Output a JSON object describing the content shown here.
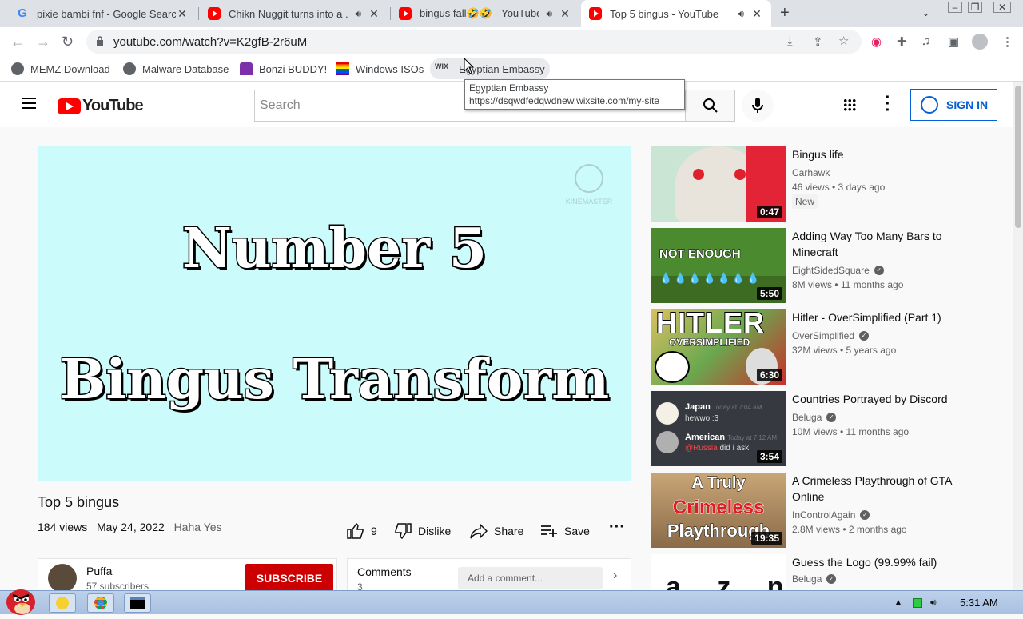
{
  "browser": {
    "tabs": [
      {
        "title": "pixie bambi fnf - Google Search",
        "favicon": "google-icon",
        "audio": false,
        "active": false
      },
      {
        "title": "Chikn Nuggit turns into a ...",
        "favicon": "youtube-icon",
        "audio": true,
        "active": false
      },
      {
        "title": "bingus fall🤣🤣 - YouTube",
        "favicon": "youtube-icon",
        "audio": true,
        "active": false
      },
      {
        "title": "Top 5 bingus - YouTube",
        "favicon": "youtube-icon",
        "audio": true,
        "active": true
      }
    ],
    "url": "youtube.com/watch?v=K2gfB-2r6uM",
    "bookmarks": [
      {
        "label": "MEMZ Download",
        "icon": "globe-icon"
      },
      {
        "label": "Malware Database",
        "icon": "globe-icon"
      },
      {
        "label": "Bonzi BUDDY!",
        "icon": "bonzi-icon"
      },
      {
        "label": "Windows ISOs",
        "icon": "rainbow-flag-icon"
      },
      {
        "label": "Egyptian Embassy",
        "icon": "wix-icon"
      }
    ],
    "tooltip": {
      "title": "Egyptian Embassy",
      "url": "https://dsqwdfedqwdnew.wixsite.com/my-site"
    }
  },
  "youtube": {
    "logo_text": "YouTube",
    "search_placeholder": "Search",
    "signin_label": "SIGN IN",
    "video": {
      "overlay_line1": "Number 5",
      "overlay_line2": "Bingus Transform",
      "watermark": "KINEMASTER",
      "title": "Top 5 bingus",
      "views": "184 views",
      "date": "May 24, 2022",
      "description": "Haha Yes",
      "likes": "9",
      "dislike_label": "Dislike",
      "share_label": "Share",
      "save_label": "Save"
    },
    "channel": {
      "name": "Puffa",
      "subscribers": "57 subscribers",
      "subscribe_label": "SUBSCRIBE"
    },
    "comments": {
      "label": "Comments",
      "count": "3",
      "placeholder": "Add a comment..."
    },
    "recommended": [
      {
        "title": "Bingus life",
        "channel": "Carhawk",
        "verified": false,
        "meta": "46 views • 3 days ago",
        "duration": "0:47",
        "badge": "New",
        "thumb_color": "#d8ede0"
      },
      {
        "title": "Adding Way Too Many Bars to Minecraft",
        "channel": "EightSidedSquare",
        "verified": true,
        "meta": "8M views • 11 months ago",
        "duration": "5:50",
        "thumb_text": "NOT ENOUGH",
        "thumb_color": "#4b8a2e"
      },
      {
        "title": "Hitler - OverSimplified (Part 1)",
        "channel": "OverSimplified",
        "verified": true,
        "meta": "32M views • 5 years ago",
        "duration": "6:30",
        "thumb_text": "HITLER",
        "thumb_sub": "OVERSIMPLIFIED",
        "thumb_color": "#c9302c"
      },
      {
        "title": "Countries Portrayed by Discord",
        "channel": "Beluga",
        "verified": true,
        "meta": "10M views • 11 months ago",
        "duration": "3:54",
        "thumb_color": "#36393f",
        "discord": [
          {
            "name": "Japan",
            "time": "Today at 7:04 AM",
            "msg": "hewwo :3"
          },
          {
            "name": "American",
            "time": "Today at 7:12 AM",
            "mention": "@Russia",
            "msg": "did i ask"
          }
        ]
      },
      {
        "title": "A Crimeless Playthrough of GTA Online",
        "channel": "InControlAgain",
        "verified": true,
        "meta": "2.8M views • 2 months ago",
        "duration": "19:35",
        "thumb_color": "#b58a5a",
        "thumb_lines": [
          "A Truly",
          "Crimeless",
          "Playthrough"
        ]
      },
      {
        "title": "Guess the Logo (99.99% fail)",
        "channel": "Beluga",
        "verified": true,
        "meta": "",
        "duration": "",
        "thumb_color": "#ffffff",
        "thumb_text": "a z n"
      }
    ]
  },
  "taskbar": {
    "clock": "5:31 AM"
  }
}
